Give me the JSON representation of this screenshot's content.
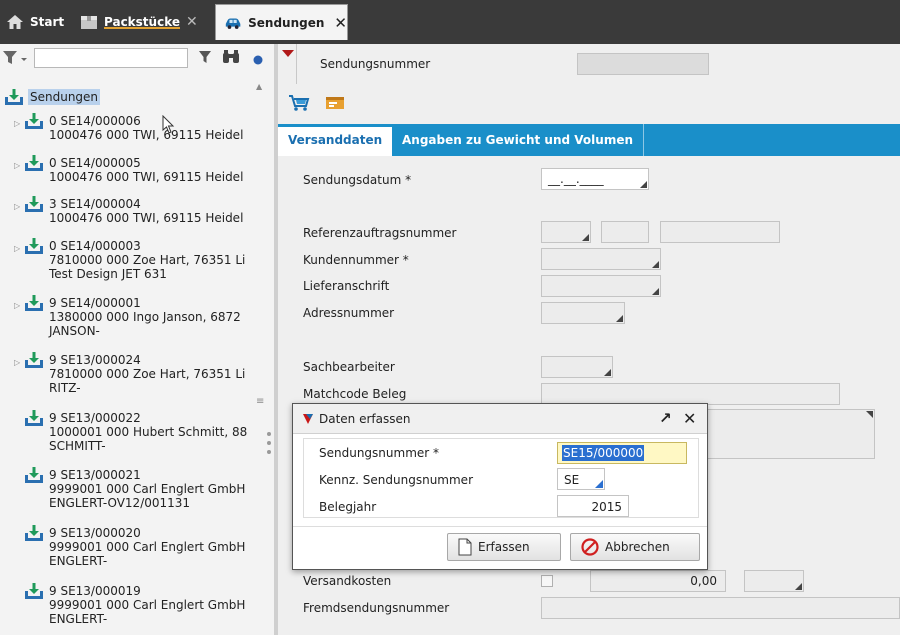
{
  "tabs": {
    "start": "Start",
    "packstuecke": "Packstücke",
    "sendungen": "Sendungen"
  },
  "filter": {
    "placeholder": ""
  },
  "tree": {
    "root": "Sendungen",
    "items": [
      {
        "l1": "0 SE14/000006",
        "l2": "1000476 000 TWI, 69115 Heidel",
        "l3": ""
      },
      {
        "l1": "0 SE14/000005",
        "l2": "1000476 000 TWI, 69115 Heidel",
        "l3": ""
      },
      {
        "l1": "3 SE14/000004",
        "l2": "1000476 000 TWI, 69115 Heidel",
        "l3": ""
      },
      {
        "l1": "0 SE14/000003",
        "l2": "7810000 000 Zoe Hart, 76351 Li",
        "l3": "Test Design JET 631"
      },
      {
        "l1": "9 SE14/000001",
        "l2": "1380000 000 Ingo Janson, 6872",
        "l3": "JANSON-"
      },
      {
        "l1": "9 SE13/000024",
        "l2": "7810000 000 Zoe Hart, 76351 Li",
        "l3": "RITZ-"
      },
      {
        "l1": "9 SE13/000022",
        "l2": "1000001 000 Hubert Schmitt, 88",
        "l3": "SCHMITT-"
      },
      {
        "l1": "9 SE13/000021",
        "l2": "9999001 000 Carl Englert GmbH",
        "l3": "ENGLERT-OV12/001131"
      },
      {
        "l1": "9 SE13/000020",
        "l2": "9999001 000 Carl Englert GmbH",
        "l3": "ENGLERT-"
      },
      {
        "l1": "9 SE13/000019",
        "l2": "9999001 000 Carl Englert GmbH",
        "l3": "ENGLERT-"
      }
    ]
  },
  "header": {
    "sendungsnummer_label": "Sendungsnummer",
    "sendungsnummer_value": ""
  },
  "formtabs": {
    "versanddaten": "Versanddaten",
    "gewicht": "Angaben zu Gewicht und Volumen"
  },
  "form": {
    "sendungsdatum": "Sendungsdatum *",
    "sendungsdatum_value": "__.__.____",
    "referenzauftragsnummer": "Referenzauftragsnummer",
    "kundennummer": "Kundennummer *",
    "lieferanschrift": "Lieferanschrift",
    "adressnummer": "Adressnummer",
    "sachbearbeiter": "Sachbearbeiter",
    "matchcode": "Matchcode Beleg",
    "versandkosten": "Versandkosten",
    "versandkosten_value": "0,00",
    "fremdsendungsnummer": "Fremdsendungsnummer"
  },
  "dialog": {
    "title": "Daten erfassen",
    "f1_label": "Sendungsnummer *",
    "f1_value": "SE15/000000",
    "f2_label": "Kennz. Sendungsnummer",
    "f2_value": "SE",
    "f3_label": "Belegjahr",
    "f3_value": "2015",
    "ok_label": "Erfassen",
    "cancel_label": "Abbrechen"
  },
  "colors": {
    "tab_accent": "#1a8fc9",
    "selection": "#2a6fd0",
    "tree_icon": "#1f9a5a",
    "cancel_icon": "#d02020"
  }
}
